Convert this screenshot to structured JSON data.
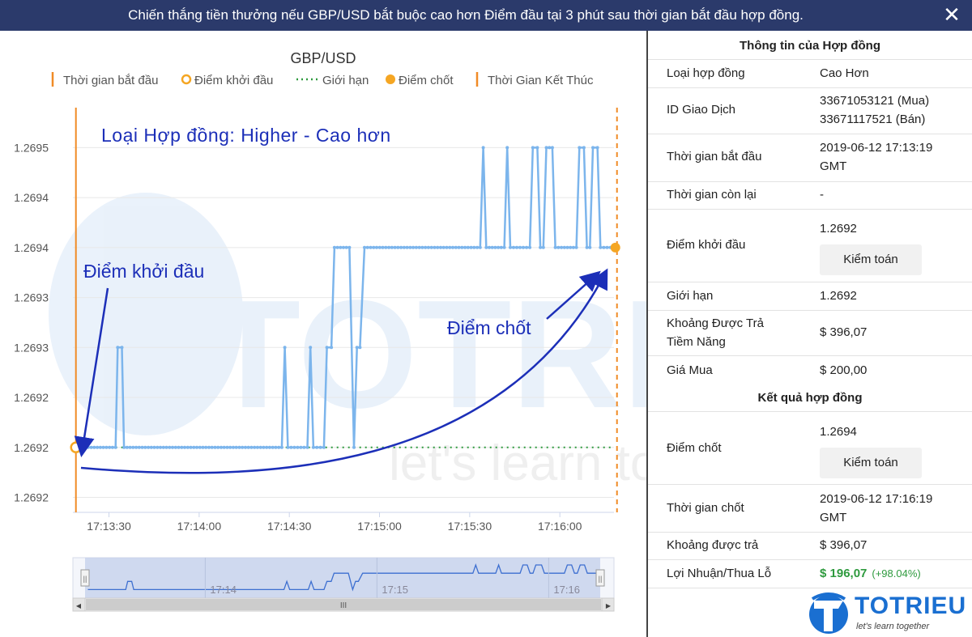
{
  "header": {
    "message": "Chiến thắng tiền thưởng nếu GBP/USD bắt buộc cao hơn Điểm đầu tại 3 phút sau thời gian bắt đầu hợp đồng.",
    "close_glyph": "✕"
  },
  "chart": {
    "title": "GBP/USD",
    "legend": [
      {
        "label": "Thời gian bắt đầu",
        "kind": "vline-solid",
        "color": "#f08b26"
      },
      {
        "label": "Điểm khởi đầu",
        "kind": "circle-hollow",
        "color": "#f5a623"
      },
      {
        "label": "Giới hạn",
        "kind": "dotted",
        "color": "#2e9a3e"
      },
      {
        "label": "Điểm chốt",
        "kind": "circle-filled",
        "color": "#f5a623"
      },
      {
        "label": "Thời Gian Kết Thúc",
        "kind": "vline-dashed",
        "color": "#f08b26"
      }
    ],
    "annotation_contract": "Loại Hợp đồng: Higher - Cao hơn",
    "annotation_entry": "Điểm khởi đầu",
    "annotation_exit": "Điểm chốt",
    "watermark_logo": "TOTRIEU",
    "watermark_slogan": "let's learn together",
    "navigator_labels": [
      "17:14",
      "17:15",
      "17:16"
    ],
    "scroll_grip": "III",
    "scroll_left": "◀",
    "scroll_right": "▶",
    "handle_glyph": "||"
  },
  "chart_data": {
    "type": "line",
    "title": "GBP/USD",
    "y_tick_labels": [
      "1.2695",
      "1.2694",
      "1.2694",
      "1.2693",
      "1.2693",
      "1.2692",
      "1.2692",
      "1.2692"
    ],
    "y_tick_values": [
      1.2695,
      1.2694,
      1.2693,
      1.2692,
      1.2691,
      1.269,
      1.2689,
      1.2688
    ],
    "ylim": [
      1.26877,
      1.26958
    ],
    "x_tick_labels": [
      "17:13:30",
      "17:14:00",
      "17:14:30",
      "17:15:00",
      "17:15:30",
      "17:16:00"
    ],
    "x_tick_values": [
      1.5,
      2.0,
      2.5,
      3.0,
      3.5,
      4.0
    ],
    "xlim": [
      1.3,
      4.3
    ],
    "x_unit": "minutes after 17:12",
    "start_x": 1.3167,
    "end_x": 4.3167,
    "entry_spot": 1.2689,
    "barrier": 1.2689,
    "exit_spot": 1.2693,
    "series": [
      {
        "name": "GBP/USD",
        "color": "#7cb5ec",
        "points": [
          [
            1.3167,
            1.2689
          ],
          [
            1.5367,
            1.2689
          ],
          [
            1.5483,
            1.2691
          ],
          [
            1.5717,
            1.2691
          ],
          [
            1.5833,
            1.2689
          ],
          [
            2.4583,
            1.2689
          ],
          [
            2.475,
            1.2691
          ],
          [
            2.4917,
            1.2689
          ],
          [
            2.6,
            1.2689
          ],
          [
            2.6167,
            1.2691
          ],
          [
            2.6333,
            1.2689
          ],
          [
            2.6917,
            1.2689
          ],
          [
            2.7083,
            1.2691
          ],
          [
            2.7333,
            1.2691
          ],
          [
            2.75,
            1.2693
          ],
          [
            2.8333,
            1.2693
          ],
          [
            2.8583,
            1.2689
          ],
          [
            2.875,
            1.2691
          ],
          [
            2.8917,
            1.2691
          ],
          [
            2.9167,
            1.2693
          ],
          [
            3.5583,
            1.2693
          ],
          [
            3.575,
            1.2695
          ],
          [
            3.5917,
            1.2693
          ],
          [
            3.6917,
            1.2693
          ],
          [
            3.7083,
            1.2695
          ],
          [
            3.725,
            1.2693
          ],
          [
            3.8333,
            1.2693
          ],
          [
            3.85,
            1.2695
          ],
          [
            3.875,
            1.2695
          ],
          [
            3.8917,
            1.2693
          ],
          [
            3.9083,
            1.2693
          ],
          [
            3.925,
            1.2695
          ],
          [
            3.9583,
            1.2695
          ],
          [
            3.975,
            1.2693
          ],
          [
            4.0917,
            1.2693
          ],
          [
            4.1083,
            1.2695
          ],
          [
            4.1333,
            1.2695
          ],
          [
            4.15,
            1.2693
          ],
          [
            4.1667,
            1.2693
          ],
          [
            4.1833,
            1.2695
          ],
          [
            4.2083,
            1.2695
          ],
          [
            4.225,
            1.2693
          ],
          [
            4.3167,
            1.2693
          ]
        ]
      }
    ],
    "grid": true,
    "legend_position": "top-center"
  },
  "info": {
    "section1_title": "Thông tin của Hợp đồng",
    "contract_type_label": "Loại hợp đồng",
    "contract_type_value": "Cao Hơn",
    "trade_id_label": "ID Giao Dịch",
    "trade_id_buy": "33671053121 (Mua)",
    "trade_id_sell": "33671117521 (Bán)",
    "start_time_label": "Thời gian bắt đầu",
    "start_time_value_1": "2019-06-12 17:13:19",
    "start_time_value_2": "GMT",
    "remaining_label": "Thời gian còn lại",
    "remaining_value": "-",
    "entry_label": "Điểm khởi đầu",
    "entry_value": "1.2692",
    "audit_label": "Kiểm toán",
    "barrier_label": "Giới hạn",
    "barrier_value": "1.2692",
    "potential_payout_label_1": "Khoảng Được Trả",
    "potential_payout_label_2": "Tiềm Năng",
    "potential_payout_value": "$ 396,07",
    "purchase_price_label": "Giá Mua",
    "purchase_price_value": "$ 200,00",
    "section2_title": "Kết quả hợp đồng",
    "exit_label": "Điểm chốt",
    "exit_value": "1.2694",
    "exit_time_label": "Thời gian chốt",
    "exit_time_value_1": "2019-06-12 17:16:19",
    "exit_time_value_2": "GMT",
    "payout_label": "Khoảng được trả",
    "payout_value": "$ 396,07",
    "pnl_label": "Lợi Nhuận/Thua Lỗ",
    "pnl_value": "$ 196,07",
    "pnl_pct": "(+98.04%)"
  },
  "logo": {
    "name": "TOTRIEU",
    "slogan": "let's learn together"
  },
  "colors": {
    "header_bg": "#2b3a6b",
    "line": "#7cb5ec",
    "start_end_line": "#f08b26",
    "barrier": "#2e9a3e",
    "annotation": "#1c2fb8",
    "profit": "#2e9a3e"
  }
}
